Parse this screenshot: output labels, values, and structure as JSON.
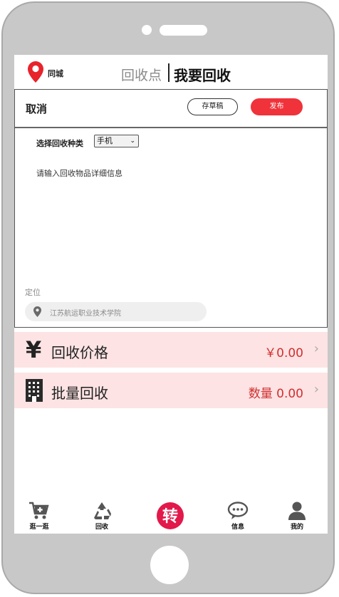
{
  "header": {
    "city": "同城",
    "tab_points": "回收点",
    "tab_recycle": "我要回收"
  },
  "form": {
    "cancel_label": "取消",
    "draft_label": "存草稿",
    "publish_label": "发布",
    "category_label": "选择回收种类",
    "category_value": "手机",
    "detail_placeholder": "请输入回收物品详细信息",
    "location_label": "定位",
    "location_value": "江苏航运职业技术学院"
  },
  "rows": {
    "price_label": "回收价格",
    "price_value": "￥0.00",
    "batch_label": "批量回收",
    "batch_value": "数量 0.00"
  },
  "tabbar": {
    "items": [
      {
        "label": "逛一逛",
        "icon": "cart-plus-icon"
      },
      {
        "label": "回收",
        "icon": "recycle-icon"
      },
      {
        "label": "",
        "icon": "zhuan-icon",
        "glyph": "转"
      },
      {
        "label": "信息",
        "icon": "chat-bubble-icon"
      },
      {
        "label": "我的",
        "icon": "user-icon"
      }
    ]
  },
  "colors": {
    "accent_red": "#f0323a",
    "row_bg": "#fde3e3",
    "value_red": "#d03032"
  }
}
